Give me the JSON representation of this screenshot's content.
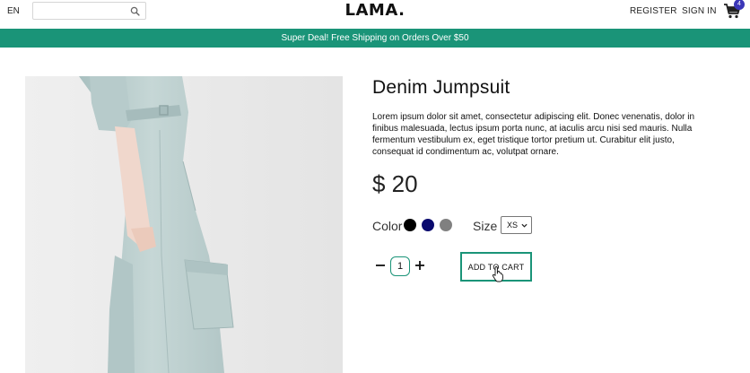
{
  "nav": {
    "language": "EN",
    "search_value": "",
    "logo": "LAMA.",
    "register": "REGISTER",
    "signin": "SIGN IN",
    "cart_count": "4"
  },
  "announcement": "Super Deal! Free Shipping on Orders Over $50",
  "product": {
    "title": "Denim Jumpsuit",
    "description": "Lorem ipsum dolor sit amet, consectetur adipiscing elit. Donec venenatis, dolor in finibus malesuada, lectus ipsum porta nunc, at iaculis arcu nisi sed mauris. Nulla fermentum vestibulum ex, eget tristique tortor pretium ut. Curabitur elit justo, consequat id condimentum ac, volutpat ornare.",
    "price": "$ 20"
  },
  "filters": {
    "color_label": "Color",
    "colors": [
      "#000000",
      "#0a0a6e",
      "#808080"
    ],
    "size_label": "Size",
    "size_selected": "XS"
  },
  "quantity": "1",
  "add_to_cart": "ADD TO CART",
  "theme": {
    "accent": "#1a9478",
    "badge": "#3b37b8"
  }
}
